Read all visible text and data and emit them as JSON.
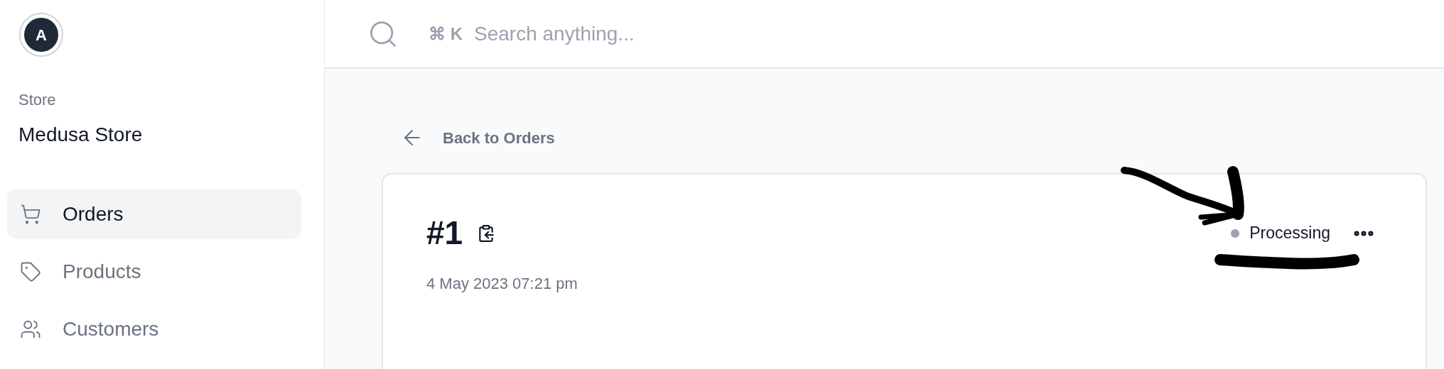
{
  "sidebar": {
    "avatar": "A",
    "store_label": "Store",
    "store_name": "Medusa Store",
    "items": [
      {
        "label": "Orders",
        "selected": true
      },
      {
        "label": "Products",
        "selected": false
      },
      {
        "label": "Customers",
        "selected": false
      }
    ]
  },
  "search": {
    "shortcut": "⌘ K",
    "placeholder": "Search anything..."
  },
  "back_link": "Back to Orders",
  "order": {
    "number": "#1",
    "date": "4 May 2023 07:21 pm",
    "status": {
      "label": "Processing",
      "color": "#9ca3af"
    }
  }
}
